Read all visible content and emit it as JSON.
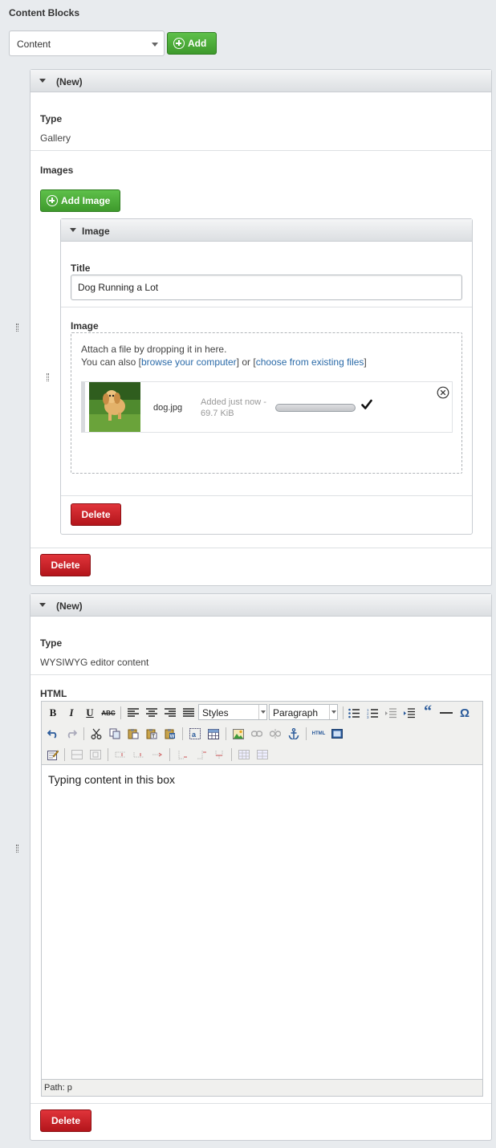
{
  "header": {
    "title": "Content Blocks"
  },
  "block_type_select": {
    "value": "Content"
  },
  "add_button": {
    "label": "Add"
  },
  "block1": {
    "title": "(New)",
    "type_label": "Type",
    "type_value": "Gallery",
    "images_label": "Images",
    "add_image_label": "Add Image",
    "image_panel": {
      "title": "Image",
      "title_label": "Title",
      "title_value": "Dog Running a Lot",
      "image_label": "Image",
      "dropzone_text1": "Attach a file by dropping it in here.",
      "dropzone_text2_prefix": "You can also [",
      "browse_link": "browse your computer",
      "dropzone_text2_mid": "] or [",
      "existing_link": "choose from existing files",
      "dropzone_text2_suffix": "]",
      "file": {
        "name": "dog.jpg",
        "status": "Added just now -",
        "size": "69.7 KiB",
        "progress": 1.0
      },
      "delete_label": "Delete"
    },
    "delete_label": "Delete"
  },
  "block2": {
    "title": "(New)",
    "type_label": "Type",
    "type_value": "WYSIWYG editor content",
    "html_label": "HTML",
    "toolbar": {
      "styles_select": "Styles",
      "format_select": "Paragraph",
      "bold": "B",
      "italic": "I",
      "underline": "U",
      "strikethrough": "ABC",
      "html_source": "HTML",
      "blockquote": "“",
      "special_char": "Ω"
    },
    "content": "Typing content in this box",
    "path": "Path: p",
    "delete_label": "Delete"
  },
  "colors": {
    "green": "#3e9a2c",
    "red": "#c81c22",
    "link": "#2a6aa8"
  }
}
